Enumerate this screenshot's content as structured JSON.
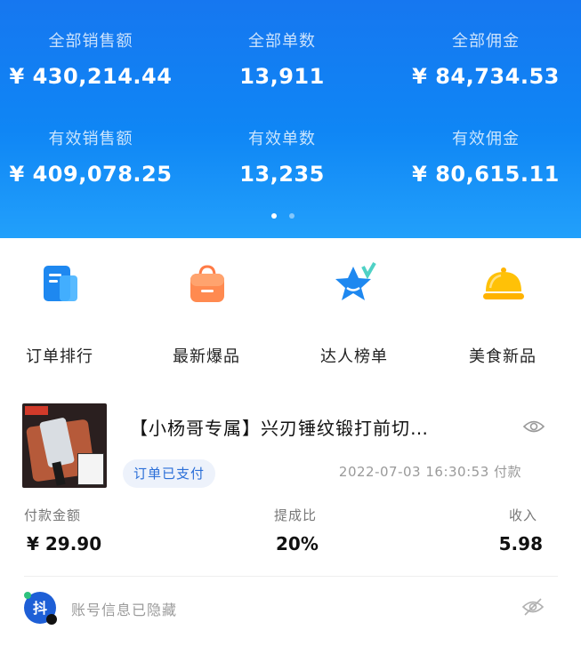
{
  "stats": {
    "row1": [
      {
        "label": "全部销售额",
        "value": "¥ 430,214.44"
      },
      {
        "label": "全部单数",
        "value": "13,911"
      },
      {
        "label": "全部佣金",
        "value": "¥ 84,734.53"
      }
    ],
    "row2": [
      {
        "label": "有效销售额",
        "value": "¥ 409,078.25"
      },
      {
        "label": "有效单数",
        "value": "13,235"
      },
      {
        "label": "有效佣金",
        "value": "¥ 80,615.11"
      }
    ]
  },
  "menu": [
    {
      "label": "订单排行",
      "icon": "document-icon",
      "color": "#1e88f0"
    },
    {
      "label": "最新爆品",
      "icon": "shopping-bag-icon",
      "color": "#ff7b46"
    },
    {
      "label": "达人榜单",
      "icon": "star-check-icon",
      "color": "#1e88f0"
    },
    {
      "label": "美食新品",
      "icon": "food-cloche-icon",
      "color": "#ffb300"
    }
  ],
  "order": {
    "title": "【小杨哥专属】兴刃锤纹锻打前切…",
    "status": "订单已支付",
    "pay_time": "2022-07-03 16:30:53 付款",
    "columns": [
      {
        "label": "付款金额",
        "value": "¥ 29.90"
      },
      {
        "label": "提成比",
        "value": "20%"
      },
      {
        "label": "收入",
        "value": "5.98"
      }
    ],
    "account_text": "账号信息已隐藏"
  },
  "colors": {
    "header_blue": "#1677f0",
    "status_blue": "#2b6fd8"
  }
}
